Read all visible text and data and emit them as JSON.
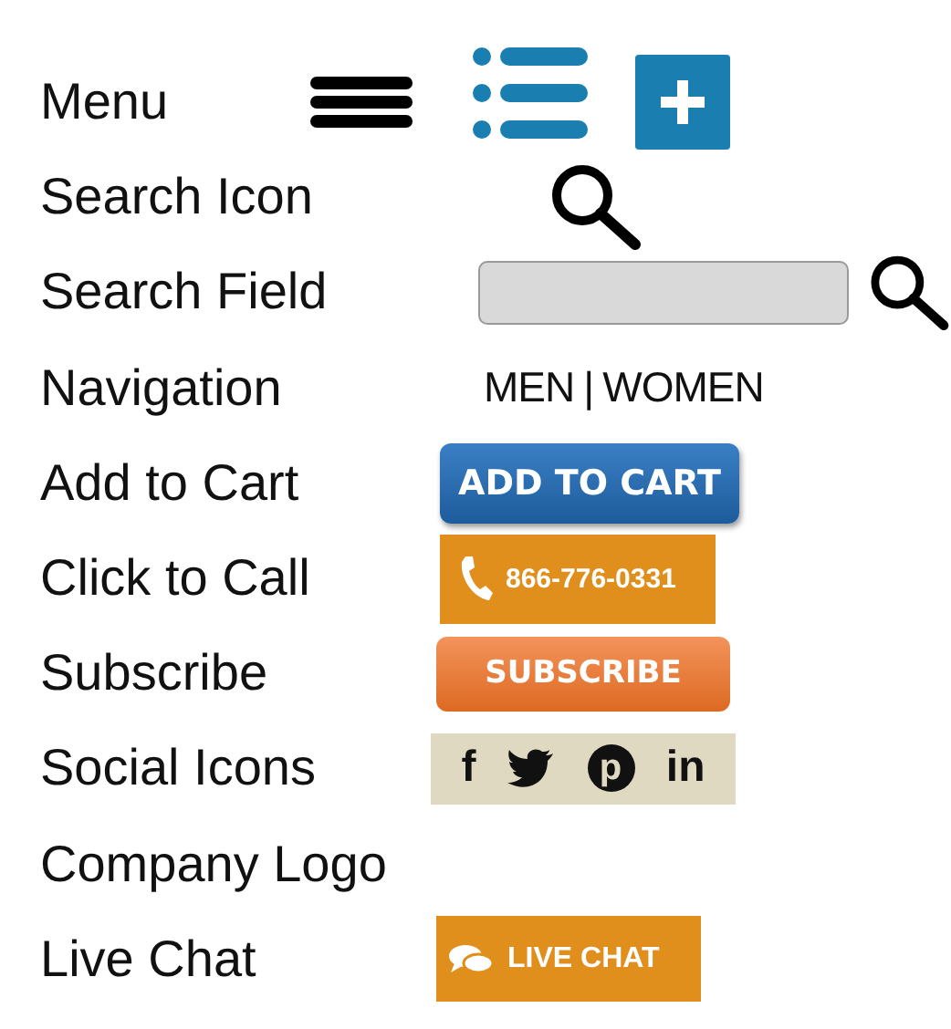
{
  "rows": [
    {
      "kind": "menu",
      "label": "Menu"
    },
    {
      "kind": "search_icon",
      "label": "Search Icon"
    },
    {
      "kind": "search_field",
      "label": "Search Field"
    },
    {
      "kind": "navigation",
      "label": "Navigation",
      "links": [
        "MEN",
        "WOMEN"
      ],
      "separator": "|"
    },
    {
      "kind": "cart",
      "label": "Add to Cart",
      "button": "ADD TO CART"
    },
    {
      "kind": "call",
      "label": "Click to Call",
      "button": "866-776-0331"
    },
    {
      "kind": "subscribe",
      "label": "Subscribe",
      "button": "SUBSCRIBE"
    },
    {
      "kind": "social",
      "label": "Social Icons",
      "facebook": "f",
      "pinterest": "p",
      "linkedin": "in"
    },
    {
      "kind": "logo",
      "label": "Company Logo"
    },
    {
      "kind": "chat",
      "label": "Live Chat",
      "button": "LIVE CHAT"
    }
  ]
}
